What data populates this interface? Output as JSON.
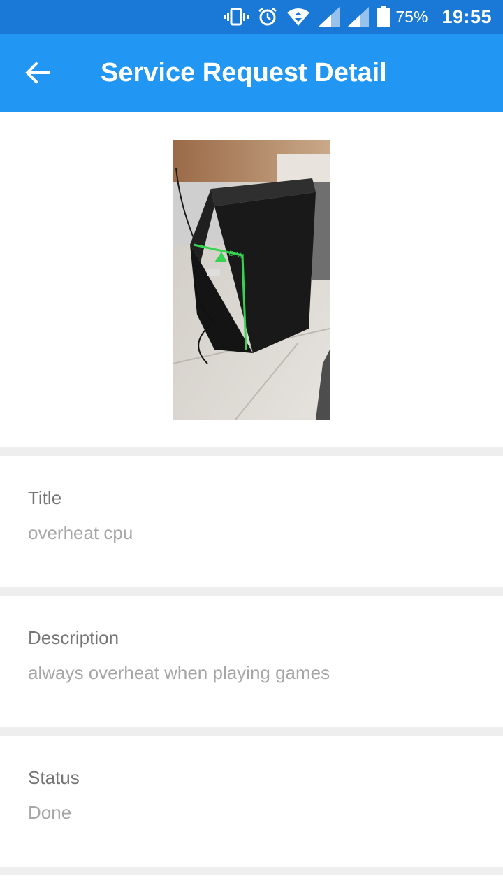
{
  "status_bar": {
    "icons": [
      "vibrate-icon",
      "alarm-icon",
      "wifi-icon",
      "signal-icon",
      "signal-icon",
      "battery-icon"
    ],
    "battery": "75%",
    "time": "19:55"
  },
  "app_bar": {
    "title": "Service Request Detail",
    "back_icon": "arrow-back-icon"
  },
  "photo": {
    "subject": "photo of a black PC tower with green accents on a tiled floor"
  },
  "details": {
    "title": {
      "label": "Title",
      "value": "overheat cpu"
    },
    "description": {
      "label": "Description",
      "value": "always overheat when playing games"
    },
    "status": {
      "label": "Status",
      "value": "Done"
    }
  },
  "colors": {
    "status_bar": "#1a78d6",
    "app_bar": "#2196f3",
    "divider": "#eeeeee",
    "label_text": "#757575",
    "value_text": "#a6a6a6"
  }
}
